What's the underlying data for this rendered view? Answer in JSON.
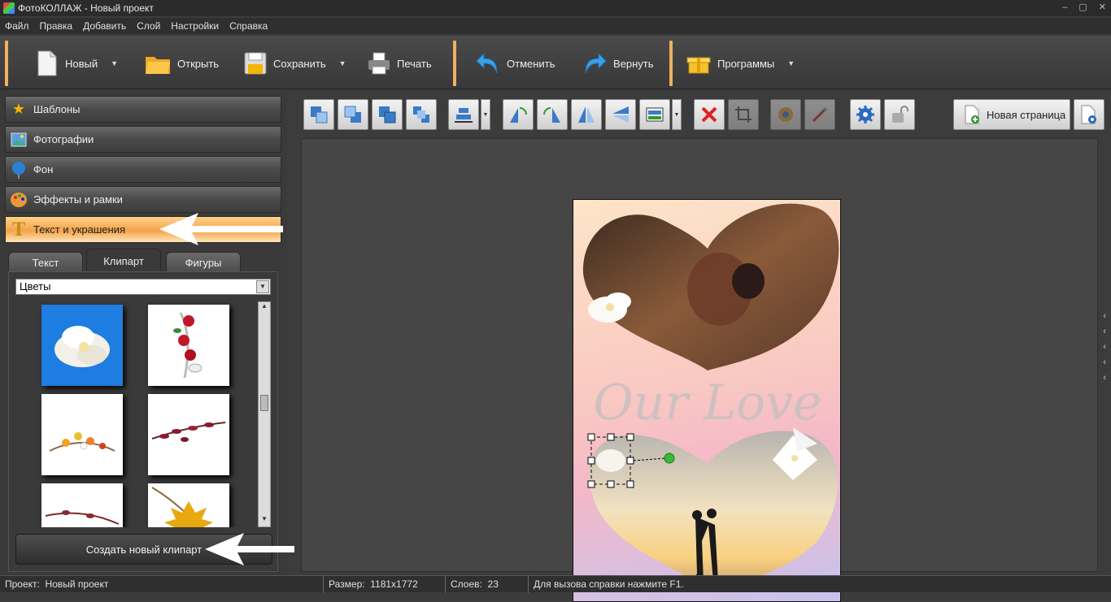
{
  "window": {
    "title": "ФотоКОЛЛАЖ - Новый проект"
  },
  "menu": [
    "Файл",
    "Правка",
    "Добавить",
    "Слой",
    "Настройки",
    "Справка"
  ],
  "toolbar": {
    "new": "Новый",
    "open": "Открыть",
    "save": "Сохранить",
    "print": "Печать",
    "undo": "Отменить",
    "redo": "Вернуть",
    "programs": "Программы"
  },
  "sections": [
    "Шаблоны",
    "Фотографии",
    "Фон",
    "Эффекты и рамки",
    "Текст и украшения"
  ],
  "tabs": [
    "Текст",
    "Клипарт",
    "Фигуры"
  ],
  "clipart": {
    "category": "Цветы",
    "create_button": "Создать новый клипарт"
  },
  "workspace": {
    "new_page": "Новая страница",
    "collage_text": "Our Love"
  },
  "status": {
    "project_label": "Проект:",
    "project_value": "Новый проект",
    "size_label": "Размер:",
    "size_value": "1181x1772",
    "layers_label": "Слоев:",
    "layers_value": "23",
    "help": "Для вызова справки нажмите F1."
  },
  "colors": {
    "accent": "#f3a24a",
    "selection": "#1e7de0"
  }
}
